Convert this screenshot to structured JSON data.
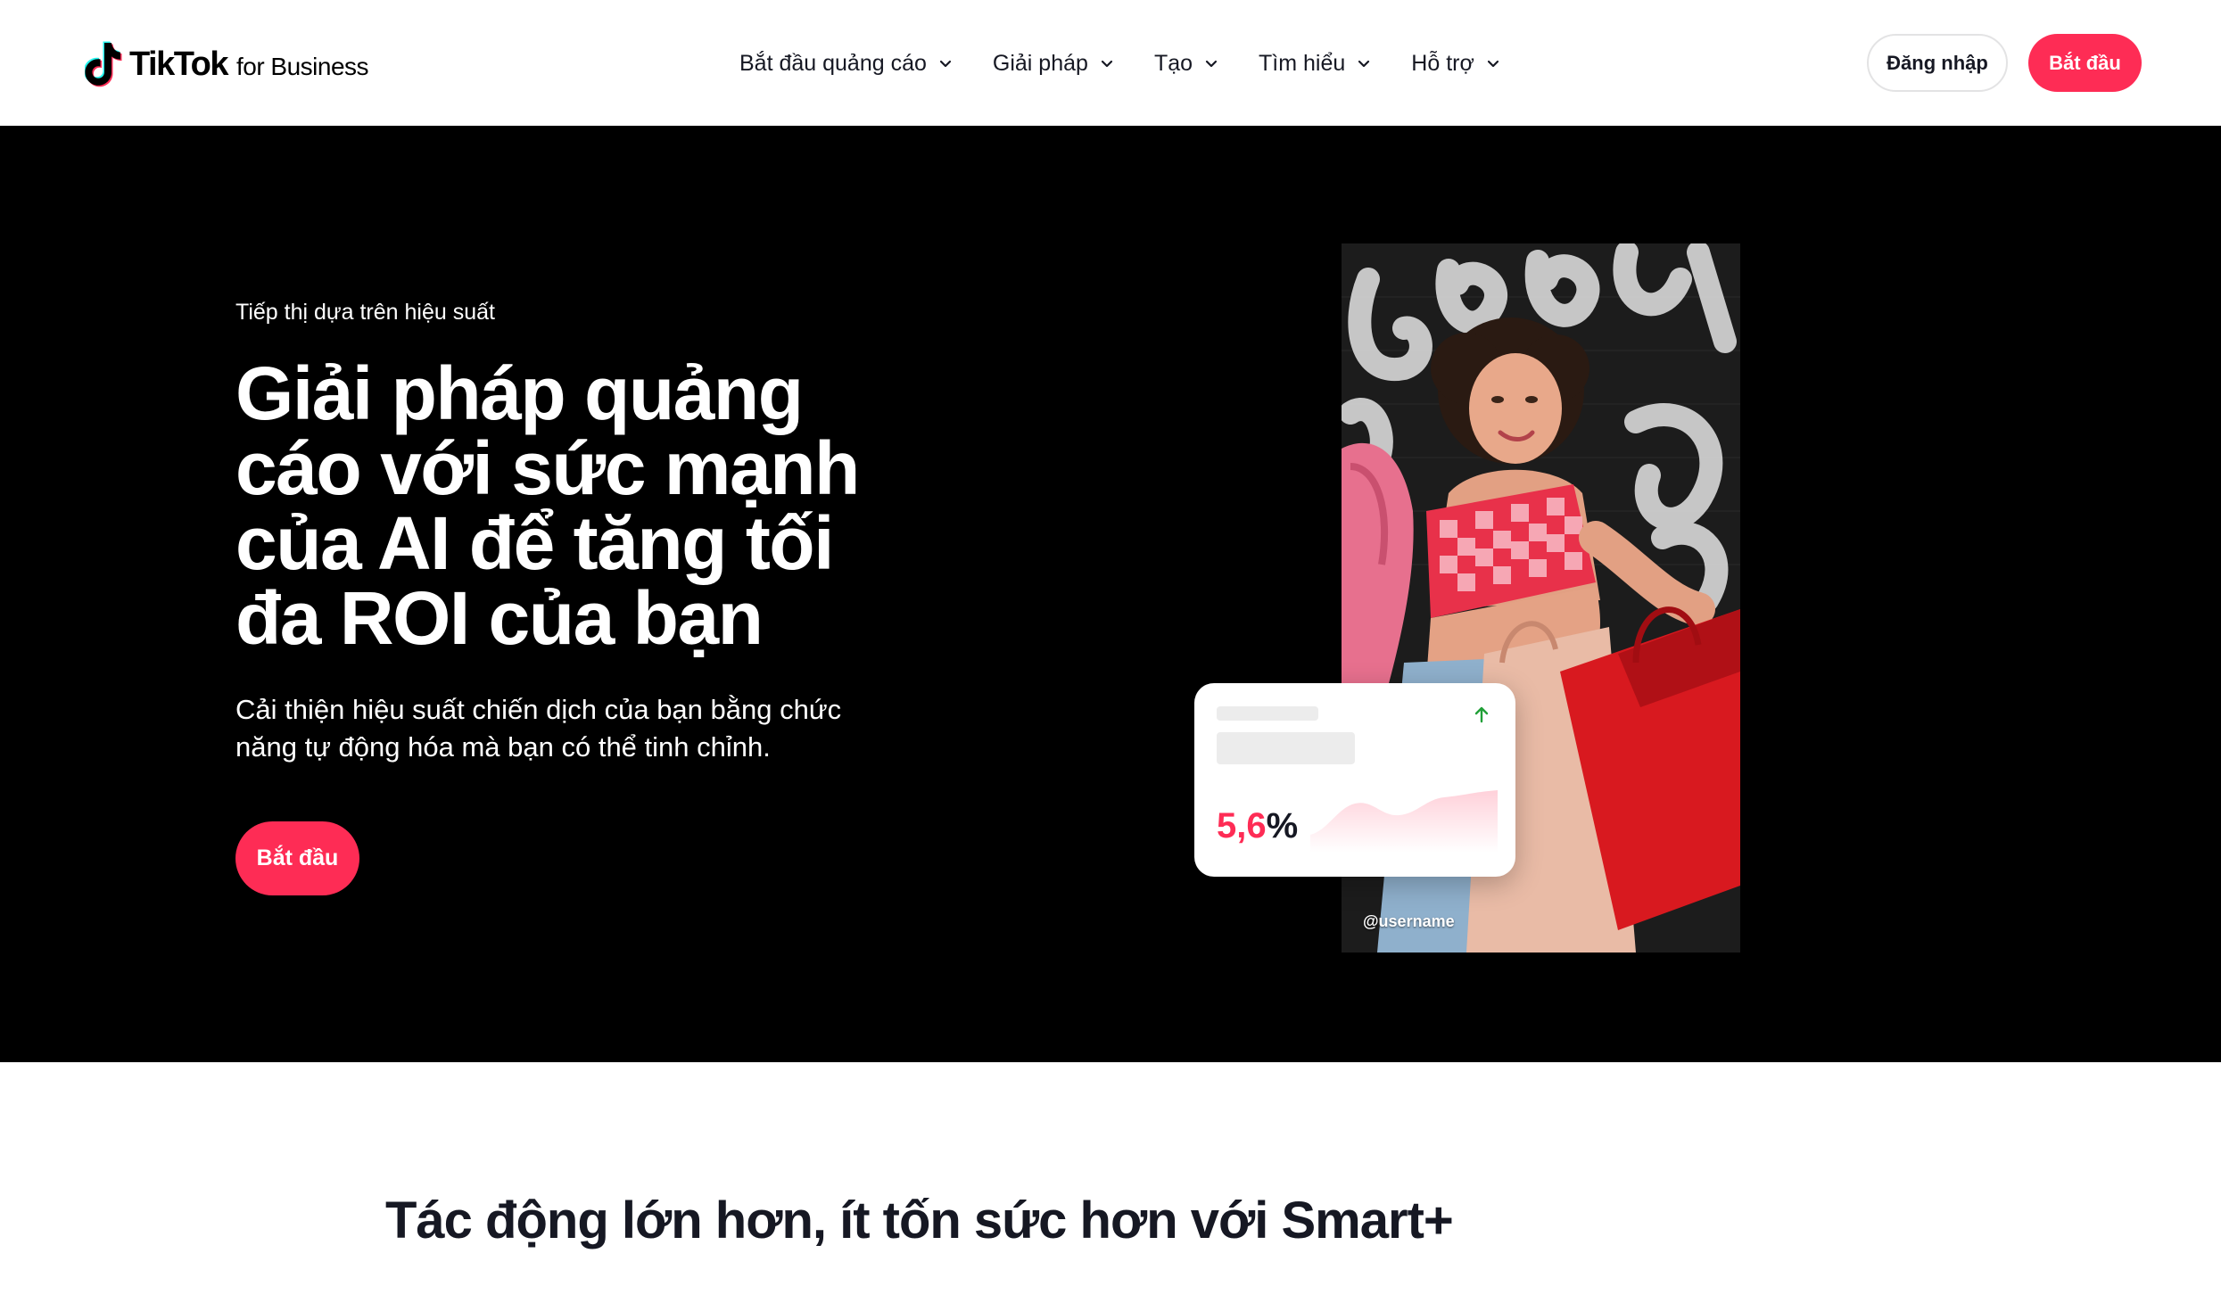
{
  "header": {
    "logo": {
      "brand": "TikTok",
      "suffix": "for Business"
    },
    "nav": [
      {
        "label": "Bắt đầu quảng cáo"
      },
      {
        "label": "Giải pháp"
      },
      {
        "label": "Tạo"
      },
      {
        "label": "Tìm hiểu"
      },
      {
        "label": "Hỗ trợ"
      }
    ],
    "login_label": "Đăng nhập",
    "start_label": "Bắt đầu"
  },
  "hero": {
    "eyebrow": "Tiếp thị dựa trên hiệu suất",
    "title": "Giải pháp quảng cáo với sức mạnh của AI để tăng tối đa ROI của bạn",
    "subtitle": "Cải thiện hiệu suất chiến dịch của bạn bằng chức năng tự động hóa mà bạn có thể tinh chỉnh.",
    "cta_label": "Bắt đầu",
    "photo_username": "@username",
    "stat": {
      "value": "5,6",
      "unit": "%",
      "trend_icon": "arrow-up-icon"
    }
  },
  "section": {
    "title": "Tác động lớn hơn, ít tốn sức hơn với Smart+"
  },
  "colors": {
    "brand": "#fe2c55",
    "hero_bg": "#000000",
    "text": "#161823"
  }
}
